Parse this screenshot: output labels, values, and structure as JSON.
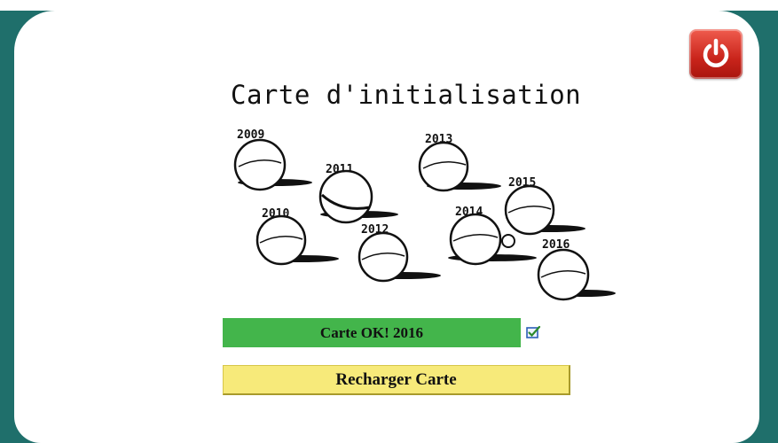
{
  "title": "Carte d'initialisation",
  "years": [
    "2009",
    "2011",
    "2013",
    "2015",
    "2010",
    "2012",
    "2014",
    "2016"
  ],
  "status": {
    "text": "Carte OK! 2016",
    "checked": true,
    "color": "#43b54b"
  },
  "reload_button": {
    "label": "Recharger Carte",
    "color": "#f7ea7a"
  },
  "power_button": {
    "icon": "power-icon",
    "color": "#d42f24"
  },
  "frame_color": "#1f6f6b"
}
